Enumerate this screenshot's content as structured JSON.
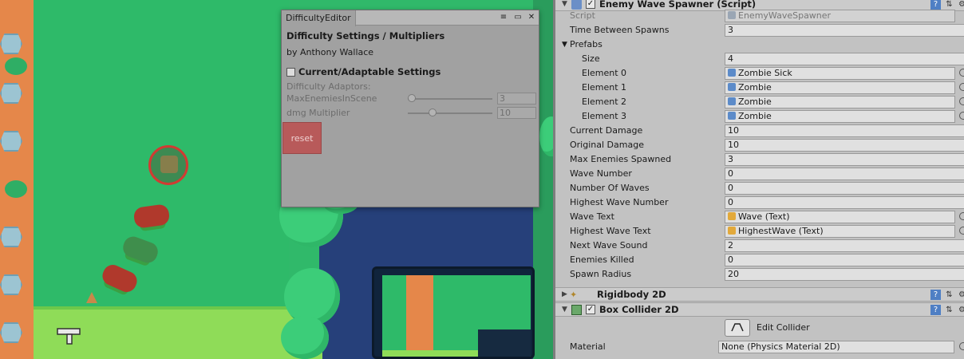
{
  "colors": {
    "scene_grass": "#2eba69",
    "scene_lawn": "#8fdc58",
    "scene_dirt": "#e5874a",
    "scene_water": "#26407a",
    "window_bg": "#a1a1a1",
    "reset_button": "#b85a5a",
    "inspector_bg": "#c2c2c2"
  },
  "difficulty_window": {
    "tab_title": "DifficultyEditor",
    "heading": "Difficulty Settings / Multipliers",
    "author": "by Anthony Wallace",
    "adaptable_label": "Current/Adaptable Settings",
    "adaptable_checked": false,
    "adaptors_label": "Difficulty Adaptors:",
    "sliders": [
      {
        "label": "MaxEnemiesInScene",
        "value": "3"
      },
      {
        "label": "dmg Multiplier",
        "value": "10"
      }
    ],
    "reset_label": "reset"
  },
  "inspector": {
    "wave_spawner": {
      "title": "Enemy Wave Spawner (Script)",
      "script_label": "Script",
      "script_value": "EnemyWaveSpawner",
      "time_between_spawns_label": "Time Between Spawns",
      "time_between_spawns": "3",
      "prefabs_label": "Prefabs",
      "size_label": "Size",
      "size": "4",
      "elements": [
        {
          "label": "Element 0",
          "value": "Zombie Sick"
        },
        {
          "label": "Element 1",
          "value": "Zombie"
        },
        {
          "label": "Element 2",
          "value": "Zombie"
        },
        {
          "label": "Element 3",
          "value": "Zombie"
        }
      ],
      "fields": [
        {
          "label": "Current Damage",
          "value": "10"
        },
        {
          "label": "Original Damage",
          "value": "10"
        },
        {
          "label": "Max Enemies Spawned",
          "value": "3"
        },
        {
          "label": "Wave Number",
          "value": "0"
        },
        {
          "label": "Number Of Waves",
          "value": "0"
        },
        {
          "label": "Highest Wave Number",
          "value": "0"
        }
      ],
      "wave_text_label": "Wave Text",
      "wave_text": "Wave (Text)",
      "highest_wave_text_label": "Highest Wave Text",
      "highest_wave_text": "HighestWave (Text)",
      "next_wave_sound_label": "Next Wave Sound",
      "next_wave_sound": "2",
      "enemies_killed_label": "Enemies Killed",
      "enemies_killed": "0",
      "spawn_radius_label": "Spawn Radius",
      "spawn_radius": "20"
    },
    "rigidbody": {
      "title": "Rigidbody 2D"
    },
    "box_collider": {
      "title": "Box Collider 2D",
      "edit_collider_label": "Edit Collider",
      "material_label": "Material",
      "material_value": "None (Physics Material 2D)"
    }
  }
}
